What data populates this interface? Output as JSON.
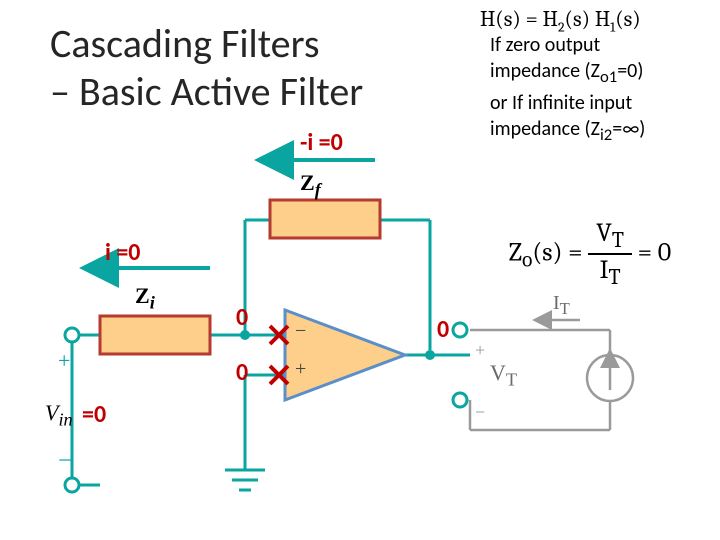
{
  "title": {
    "line1": "Cascading Filters",
    "line2": "– Basic Active Filter"
  },
  "equations": {
    "transfer": {
      "lhs": "H(s)",
      "rhs_a": "H",
      "sub_a": "2",
      "mid": "(s)",
      "rhs_b": "H",
      "sub_b": "1",
      "tail": "(s)"
    },
    "zout": {
      "lhs": "Z",
      "lhs_sub": "o",
      "s": "(s)",
      "num_v": "V",
      "num_sub": "T",
      "den_i": "I",
      "den_sub": "T",
      "eq_zero": "= 0"
    }
  },
  "condition": {
    "l1": "If zero output",
    "l2": "impedance (Z",
    "l2_sub": "o1",
    "l2_tail": "=0)",
    "l3": "or  If infinite input",
    "l4": "impedance (Z",
    "l4_sub": "i2",
    "l4_tail": "=∞)"
  },
  "circuit": {
    "labels": {
      "Zi": "Z",
      "Zi_sub": "i",
      "Zf": "Z",
      "Zf_sub": "f",
      "Vin": "V",
      "Vin_sub": "in",
      "Vin_zero": "=0",
      "VT": "V",
      "VT_sub": "T",
      "IT": "I",
      "IT_sub": "T",
      "amp_minus": "−",
      "amp_plus": "+",
      "i_eq0": "i =0",
      "neg_i_eq0": "-i =0",
      "zero_top": "0",
      "zero_bot": "0",
      "zero_out": "0"
    },
    "colors": {
      "wire": "#0aa5a0",
      "comp_fill": "#fecf8a",
      "comp_stroke": "#b53a2f",
      "amp_fill": "#fecf8a",
      "amp_stroke": "#5a8fc8",
      "x_mark": "#c00000",
      "ann": "#c00000",
      "gray": "#9a9a9a"
    }
  }
}
